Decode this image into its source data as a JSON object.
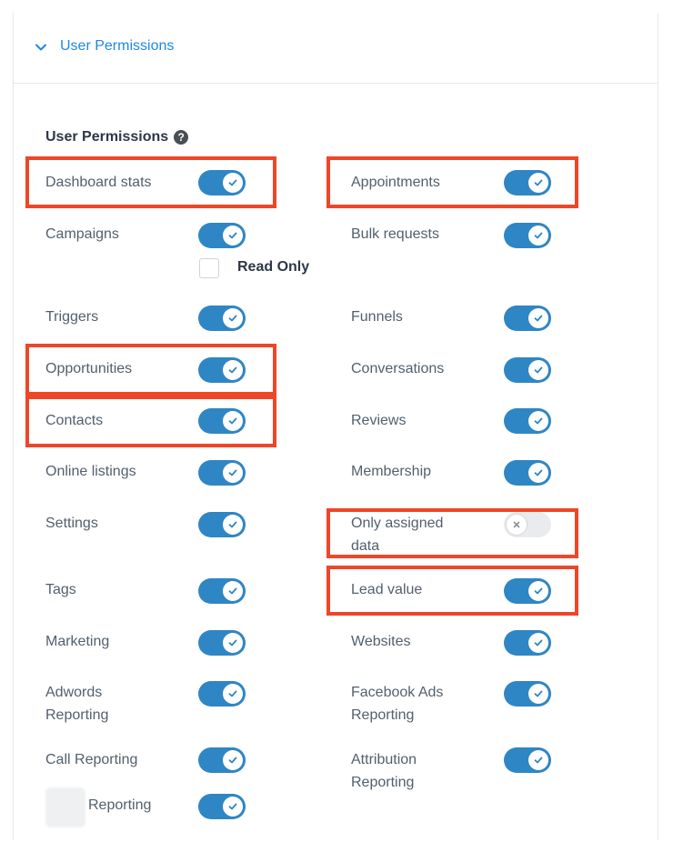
{
  "header": {
    "title": "User Permissions"
  },
  "section": {
    "title": "User Permissions",
    "help_glyph": "?"
  },
  "read_only": {
    "label": "Read Only",
    "checked": false
  },
  "permissions_left": [
    {
      "label": "Dashboard stats",
      "enabled": true
    },
    {
      "label": "Campaigns",
      "enabled": true
    },
    {
      "label": "Triggers",
      "enabled": true
    },
    {
      "label": "Opportunities",
      "enabled": true
    },
    {
      "label": "Contacts",
      "enabled": true
    },
    {
      "label": "Online listings",
      "enabled": true
    },
    {
      "label": "Settings",
      "enabled": true
    },
    {
      "label": "Tags",
      "enabled": true
    },
    {
      "label": "Marketing",
      "enabled": true
    },
    {
      "label": "Adwords Reporting",
      "enabled": true
    },
    {
      "label": "Call Reporting",
      "enabled": true
    },
    {
      "label": "Reporting",
      "enabled": true
    }
  ],
  "permissions_right": [
    {
      "label": "Appointments",
      "enabled": true
    },
    {
      "label": "Bulk requests",
      "enabled": true
    },
    {
      "label": "Funnels",
      "enabled": true
    },
    {
      "label": "Conversations",
      "enabled": true
    },
    {
      "label": "Reviews",
      "enabled": true
    },
    {
      "label": "Membership",
      "enabled": true
    },
    {
      "label": "Only assigned data",
      "enabled": false
    },
    {
      "label": "Lead value",
      "enabled": true
    },
    {
      "label": "Websites",
      "enabled": true
    },
    {
      "label": "Facebook Ads Reporting",
      "enabled": true
    },
    {
      "label": "Attribution Reporting",
      "enabled": true
    }
  ],
  "colors": {
    "accent": "#2f86c4",
    "link": "#1e88e5",
    "highlight": "#ee4628"
  }
}
